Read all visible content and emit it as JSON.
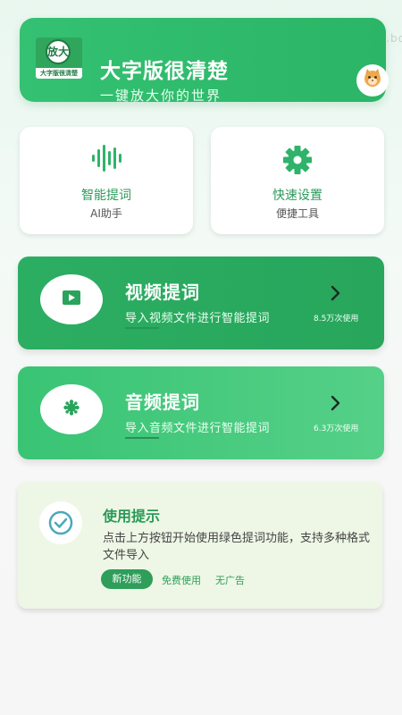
{
  "watermark": "com.bo",
  "header": {
    "logo_big": "放大",
    "logo_strip": "大字版很清楚",
    "title": "大字版很清楚",
    "subtitle": "一键放大你的世界",
    "avatar": "cat-avatar-icon"
  },
  "tiles": [
    {
      "label": "智能提词",
      "sub": "AI助手",
      "icon": "voice-wave-icon"
    },
    {
      "label": "快速设置",
      "sub": "便捷工具",
      "icon": "gear-icon"
    }
  ],
  "features": [
    {
      "title": "视频提词",
      "desc": "导入视频文件进行智能提词",
      "count": "8.5万次使用",
      "icon": "play-icon"
    },
    {
      "title": "音频提词",
      "desc": "导入音频文件进行智能提词",
      "count": "6.3万次使用",
      "icon": "audio-blob-icon"
    }
  ],
  "tips": {
    "title": "使用提示",
    "text": "点击上方按钮开始使用绿色提词功能，支持多种格式文件导入",
    "tags": [
      "新功能",
      "免费使用",
      "无广告"
    ]
  },
  "colors": {
    "primary": "#2bb566",
    "accent_dark": "#2e9e5a",
    "tip_bg": "#eef7e6"
  }
}
